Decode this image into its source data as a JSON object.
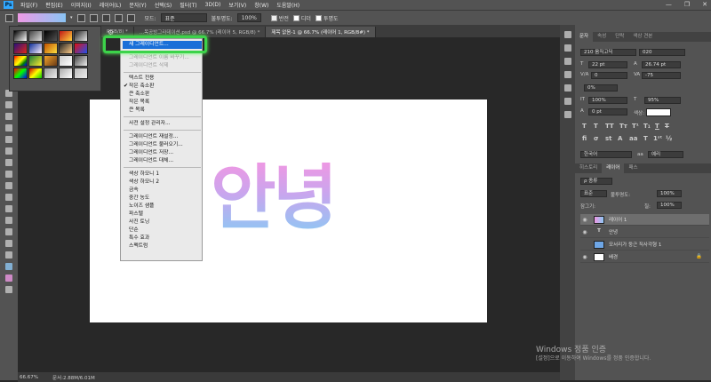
{
  "menubar": {
    "logo": "Ps",
    "items": [
      "파일(F)",
      "편집(E)",
      "이미지(I)",
      "레이어(L)",
      "문자(Y)",
      "선택(S)",
      "필터(T)",
      "3D(D)",
      "보기(V)",
      "창(W)",
      "도움말(H)"
    ],
    "controls": [
      "—",
      "❐",
      "✕"
    ]
  },
  "options": {
    "mode_label": "모드:",
    "mode_value": "표준",
    "opacity_label": "불투명도:",
    "opacity_value": "100%",
    "reverse_label": "반전",
    "dither_label": "디더",
    "transparency_label": "투명도",
    "gradient_colors": [
      "#ee9ae5",
      "#89c4f4"
    ]
  },
  "tabs": [
    {
      "label": "RGB/8) *"
    },
    {
      "label": "...목공방그라데이션.psd @ 66.7% (레이어 5, RGB/8) *"
    },
    {
      "label": "제목 없음-1 @ 66.7% (레이어 1, RGB/8#) *"
    }
  ],
  "canvas": {
    "text": "안녕"
  },
  "gradient_presets": [
    "linear-gradient(135deg,#000,#fff)",
    "linear-gradient(135deg,#444,#ddd)",
    "linear-gradient(135deg,#000,transparent)",
    "linear-gradient(135deg,#c01616,#ffd23c)",
    "linear-gradient(135deg,#222,#e8e8e8)",
    "linear-gradient(135deg,#2a0f7a,#e0281a)",
    "linear-gradient(135deg,#0d2e9a,#fff0ff)",
    "linear-gradient(135deg,#c05000,#ffe040)",
    "linear-gradient(135deg,#222,#ffcc88)",
    "linear-gradient(135deg,#e01010,#2050f0)",
    "linear-gradient(135deg,red,orange,yellow,green,blue)",
    "linear-gradient(135deg,#1b7d3a,#ffeb2e)",
    "linear-gradient(135deg,#f2a22a,#6b3b17)",
    "linear-gradient(135deg,#ccc,#fff)",
    "linear-gradient(135deg,#444,#eee)",
    "linear-gradient(135deg,#f00,#0f0,#00f)",
    "linear-gradient(135deg,#c00,#ff0,#0c0)",
    "linear-gradient(135deg,#999,#eee)",
    "linear-gradient(135deg,#aaa,#fff)",
    "linear-gradient(135deg,#bbb,#eee)"
  ],
  "context_menu": {
    "highlighted": "새 그레이디언트...",
    "items": [
      {
        "label": "그레이디언트 이름 바꾸기...",
        "disabled": true
      },
      {
        "label": "그레이디언트 삭제",
        "disabled": true
      },
      {
        "label": "텍스트 전용"
      },
      {
        "label": "작은 축소판",
        "checked": true
      },
      {
        "label": "큰 축소판"
      },
      {
        "label": "작은 목록"
      },
      {
        "label": "큰 목록"
      },
      {
        "label": "사전 설정 관리자..."
      },
      {
        "label": "그레이디언트 재설정..."
      },
      {
        "label": "그레이디언트 불러오기..."
      },
      {
        "label": "그레이디언트 저장..."
      },
      {
        "label": "그레이디언트 대체..."
      },
      {
        "label": "색상 하모니 1"
      },
      {
        "label": "색상 하모니 2"
      },
      {
        "label": "금속"
      },
      {
        "label": "중간 농도"
      },
      {
        "label": "노이즈 샘플"
      },
      {
        "label": "파스텔"
      },
      {
        "label": "사진 토닝"
      },
      {
        "label": "단순"
      },
      {
        "label": "특수 효과"
      },
      {
        "label": "스펙트럼"
      }
    ]
  },
  "char_panel": {
    "tabs": [
      "문자",
      "속성",
      "단락",
      "색상 견본"
    ],
    "font": "210 움직고딕",
    "weight": "020",
    "size": "22 pt",
    "leading": "26.74 pt",
    "kerning": "0",
    "tracking": "-75",
    "scale_pct": "0%",
    "vscale": "100%",
    "hscale": "95%",
    "baseline": "0 pt",
    "color_label": "색상:",
    "aa_mode": "선명",
    "lang": "한국어",
    "aa_label": "예리"
  },
  "layers_panel": {
    "tabs": [
      "히스토리",
      "레이어",
      "패스"
    ],
    "kind": "ρ 종류",
    "blend": "표준",
    "opacity_label": "불투명도:",
    "opacity": "100%",
    "lock_label": "잠그기:",
    "fill_label": "칠:",
    "fill": "100%",
    "layers": [
      {
        "name": "레이어 1",
        "selected": true,
        "thumb": "linear-gradient(90deg,#ee98e3,#8ec7f3)"
      },
      {
        "name": "안녕",
        "type_layer": true
      },
      {
        "name": "모서리가 둥근 직사각형 1",
        "thumb": "#6ea6e6"
      },
      {
        "name": "배경",
        "thumb": "#ffffff",
        "locked": true
      }
    ]
  },
  "status": {
    "zoom": "66.67%",
    "doc": "문서:2.88M/6.01M"
  },
  "watermark": {
    "line1": "Windows 정품 인증",
    "line2": "[설정]으로 이동하여 Windows를 정품 인증합니다."
  },
  "colors": {
    "accent": "#1a6fd8",
    "callout": "#3cd34a"
  }
}
